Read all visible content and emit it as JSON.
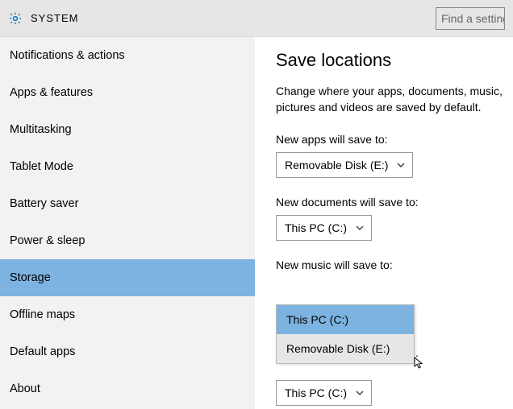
{
  "header": {
    "title": "SYSTEM",
    "search_placeholder": "Find a setting"
  },
  "sidebar": {
    "items": [
      {
        "label": "Notifications & actions",
        "selected": false
      },
      {
        "label": "Apps & features",
        "selected": false
      },
      {
        "label": "Multitasking",
        "selected": false
      },
      {
        "label": "Tablet Mode",
        "selected": false
      },
      {
        "label": "Battery saver",
        "selected": false
      },
      {
        "label": "Power & sleep",
        "selected": false
      },
      {
        "label": "Storage",
        "selected": true
      },
      {
        "label": "Offline maps",
        "selected": false
      },
      {
        "label": "Default apps",
        "selected": false
      },
      {
        "label": "About",
        "selected": false
      }
    ]
  },
  "main": {
    "title": "Save locations",
    "description": "Change where your apps, documents, music, pictures and videos are saved by default.",
    "sections": {
      "apps": {
        "label": "New apps will save to:",
        "value": "Removable Disk (E:)"
      },
      "documents": {
        "label": "New documents will save to:",
        "value": "This PC (C:)"
      },
      "music": {
        "label": "New music will save to:",
        "options": [
          {
            "label": "This PC (C:)",
            "selected": true
          },
          {
            "label": "Removable Disk (E:)",
            "selected": false
          }
        ]
      },
      "below": {
        "value": "This PC (C:)"
      }
    }
  }
}
